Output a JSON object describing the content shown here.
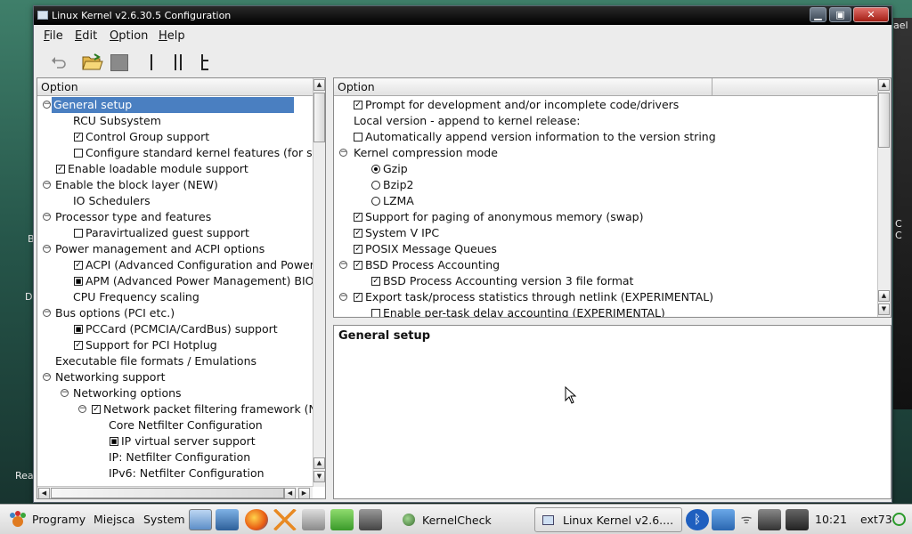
{
  "desktop": {
    "labels": [
      "Do",
      "Rea",
      "B"
    ],
    "right_labels": [
      "C",
      "C",
      "ael"
    ]
  },
  "window": {
    "title": "Linux Kernel v2.6.30.5 Configuration",
    "min_icon": "minimize-icon",
    "max_icon": "maximize-icon",
    "close_icon": "close-icon"
  },
  "menu": [
    "File",
    "Edit",
    "Option",
    "Help"
  ],
  "toolbar": {
    "icons": [
      "undo-icon",
      "open-folder-icon",
      "save-icon",
      "single-view-icon",
      "split-view-icon",
      "full-tree-view-icon"
    ]
  },
  "left_panel": {
    "header": "Option",
    "items": [
      {
        "label": "General setup",
        "expander": "minus",
        "selected": true
      },
      {
        "label": "RCU Subsystem"
      },
      {
        "label": "Control Group support",
        "check": "checked"
      },
      {
        "label": "Configure standard kernel features (for sm",
        "check": "unchecked"
      },
      {
        "label": "Enable loadable module support",
        "check": "checked"
      },
      {
        "label": "Enable the block layer (NEW)",
        "expander": "minus"
      },
      {
        "label": "IO Schedulers"
      },
      {
        "label": "Processor type and features",
        "expander": "minus"
      },
      {
        "label": "Paravirtualized guest support",
        "check": "unchecked"
      },
      {
        "label": "Power management and ACPI options",
        "expander": "minus"
      },
      {
        "label": "ACPI (Advanced Configuration and Power",
        "check": "checked"
      },
      {
        "label": "APM (Advanced Power Management) BIOS",
        "check": "module"
      },
      {
        "label": "CPU Frequency scaling"
      },
      {
        "label": "Bus options (PCI etc.)",
        "expander": "minus"
      },
      {
        "label": "PCCard (PCMCIA/CardBus) support",
        "check": "module"
      },
      {
        "label": "Support for PCI Hotplug",
        "check": "checked"
      },
      {
        "label": "Executable file formats / Emulations"
      },
      {
        "label": "Networking support",
        "expander": "minus"
      },
      {
        "label": "Networking options",
        "expander": "minus"
      },
      {
        "label": "Network packet filtering framework (N",
        "expander": "minus",
        "check": "checked"
      },
      {
        "label": "Core Netfilter Configuration"
      },
      {
        "label": "IP virtual server support",
        "check": "module"
      },
      {
        "label": "IP: Netfilter Configuration"
      },
      {
        "label": "IPv6: Netfilter Configuration"
      }
    ]
  },
  "right_panel": {
    "header": "Option",
    "items": [
      {
        "label": "Prompt for development and/or incomplete code/drivers",
        "check": "checked"
      },
      {
        "label": "Local version - append to kernel release:"
      },
      {
        "label": "Automatically append version information to the version string",
        "check": "unchecked"
      },
      {
        "label": "Kernel compression mode",
        "expander": "minus"
      },
      {
        "label": "Gzip",
        "radio": "on"
      },
      {
        "label": "Bzip2",
        "radio": "off"
      },
      {
        "label": "LZMA",
        "radio": "off"
      },
      {
        "label": "Support for paging of anonymous memory (swap)",
        "check": "checked"
      },
      {
        "label": "System V IPC",
        "check": "checked"
      },
      {
        "label": "POSIX Message Queues",
        "check": "checked"
      },
      {
        "label": "BSD Process Accounting",
        "expander": "minus",
        "check": "checked"
      },
      {
        "label": "BSD Process Accounting version 3 file format",
        "check": "checked"
      },
      {
        "label": "Export task/process statistics through netlink (EXPERIMENTAL)",
        "expander": "minus",
        "check": "checked"
      },
      {
        "label": "Enable per-task delay accounting (EXPERIMENTAL)",
        "check": "unchecked"
      }
    ]
  },
  "help_panel": {
    "title": "General setup"
  },
  "taskbar": {
    "menus": [
      "Programy",
      "Miejsca",
      "System"
    ],
    "tasks": [
      "KernelCheck",
      "Linux Kernel v2.6...."
    ],
    "clock": "10:21",
    "user": "ext73"
  }
}
